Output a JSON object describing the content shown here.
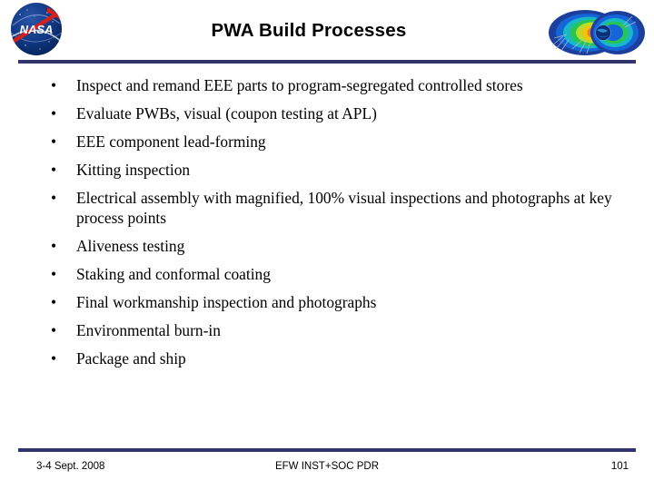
{
  "slide": {
    "title": "PWA Build Processes",
    "bullet_char": "•",
    "bullets": [
      {
        "text": "Inspect and remand EEE parts to program-segregated controlled stores"
      },
      {
        "text": "Evaluate PWBs, visual (coupon testing at APL)"
      },
      {
        "text": "EEE component lead-forming"
      },
      {
        "text": "Kitting inspection"
      },
      {
        "text": "Electrical assembly with magnified, 100% visual inspections and photographs at key process points"
      },
      {
        "text": "Aliveness testing"
      },
      {
        "text": "Staking and conformal coating"
      },
      {
        "text": "Final workmanship inspection and photographs"
      },
      {
        "text": "Environmental burn-in"
      },
      {
        "text": "Package and ship"
      }
    ]
  },
  "header": {
    "nasa_logo_label": "NASA",
    "rule_color": "#33336b"
  },
  "footer": {
    "date": "3-4 Sept. 2008",
    "center": "EFW INST+SOC PDR",
    "page": "101",
    "rule_color": "#33336b"
  }
}
